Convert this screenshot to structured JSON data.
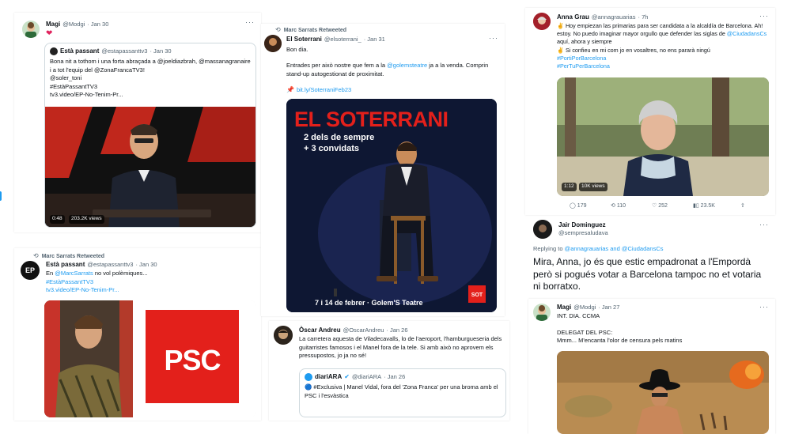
{
  "colors": {
    "accent": "#1d9bf0",
    "muted": "#536471",
    "psc_red": "#e3201b",
    "soterrani_bg": "#0f1a3a"
  },
  "tweet1": {
    "name": "Magi",
    "handle": "@Modgi",
    "date": "· Jan 30",
    "text": "❤",
    "quote": {
      "name": "Està passant",
      "handle": "@estapassanttv3",
      "date": "· Jan 30",
      "text": "Bona nit a tothom i una forta abraçada a @joeldiazbrah, @massanagranaire i a tot l'equip del @ZonaFrancaTV3!\n@soler_toni\n#EstàPassantTV3\ntv3.video/EP-No-Tenim-Pr...",
      "video_time": "0:48",
      "video_views": "203.2K views"
    }
  },
  "tweet2": {
    "retweeted": "Marc Sarrats Retweeted",
    "name": "Està passant",
    "handle": "@estapassanttv3",
    "date": "· Jan 30",
    "avatar_text": "EP",
    "text_pre": "En ",
    "mention": "@MarcSarrats",
    "text_post": " no vol polèmiques...",
    "hashtag": "#EstàPassantTV3",
    "url": "tv3.video/EP-No-Tenim-Pr...",
    "logo": "PSC"
  },
  "tweet3": {
    "retweeted": "Marc Sarrats Retweeted",
    "name": "El Soterrani",
    "handle": "@elsoterrani_",
    "date": "· Jan 31",
    "line1": "Bon dia.",
    "line2_pre": "Entrades per això nostre que fem a la ",
    "line2_mention": "@golemsteatre",
    "line2_post": " ja a la venda. Comprin stand-up autogestionat de proximitat.",
    "link": "bit.ly/SoterraniFeb23",
    "poster": {
      "title": "EL SOTERRANI",
      "sub1": "2 dels de sempre",
      "sub2": "+ 3 convidats",
      "bottom": "7 i 14 de febrer · Golem'S Teatre",
      "logo": "SOT"
    }
  },
  "tweet4": {
    "name": "Òscar Andreu",
    "handle": "@OscarAndreu",
    "date": "· Jan 26",
    "text": "La carretera aquesta de Viladecavalls, lo de l'aeroport, l'hamburgueseria dels guitarristes famosos i el Manel fora de la tele. Si amb això no aprovem els pressupostos, jo ja no sé!",
    "quote": {
      "name": "diariARA",
      "handle": "@diariARA",
      "date": "· Jan 26",
      "text": "🔵 #Exclusiva | Manel Vidal, fora del 'Zona Franca' per una broma amb el PSC i l'esvàstica"
    }
  },
  "tweet5": {
    "name": "Anna Grau",
    "handle": "@annagrauarias",
    "date": "· 7h",
    "line1": "✌ Hoy empiezan las primarias para ser candidata a la alcaldía de Barcelona. Ah! estoy. No puedo imaginar mayor orgullo que defender las siglas de ",
    "line1_mention": "@CiudadansCs",
    "line1_post": " aquí, ahora y siempre",
    "line2": "✌ Si confieu en mi com jo en vosaltres, no ens pararà ningú",
    "hashtag1": "#PortiPorBarcelona",
    "hashtag2": "#PerTuPerBarcelona",
    "video_time": "1:12",
    "video_views": "10K views",
    "stats": {
      "replies": "179",
      "retweets": "110",
      "likes": "252",
      "views": "23.5K"
    }
  },
  "tweet6": {
    "name": "Jair Dominguez",
    "handle": "@sempresaludava",
    "replying": "Replying to ",
    "replying_to": "@annagrauarias and @CiudadansCs",
    "text": "Mira, Anna, jo és que estic empadronat a l'Empordà però si pogués votar a Barcelona tampoc no et votaria ni borratxo."
  },
  "tweet7": {
    "name": "Magi",
    "handle": "@Modgi",
    "date": "· Jan 27",
    "line1": "INT. DIA. CCMA",
    "line2": "DELEGAT DEL PSC:",
    "line3": "Mmm... M'encanta l'olor de censura pels matins"
  }
}
